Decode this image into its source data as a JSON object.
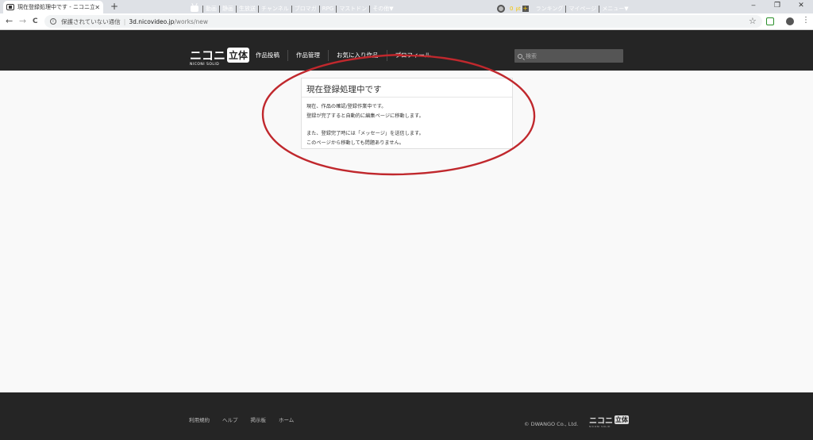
{
  "browser": {
    "tab_title": "現在登録処理中です - ニコニ立体",
    "tab_close": "✕",
    "new_tab": "+",
    "window_controls": {
      "minimize": "‒",
      "maximize": "❐",
      "close": "✕"
    },
    "nav": {
      "back": "←",
      "forward": "→",
      "reload": "C"
    },
    "security_label": "保護されていない通信",
    "url_host": "3d.nicovideo.jp",
    "url_path": "/works/new"
  },
  "topbar": {
    "links": [
      "動画",
      "静画",
      "生放送",
      "チャンネル",
      "ブロマガ",
      "RPG",
      "マストドン",
      "その他▼"
    ],
    "points": "0",
    "points_unit": "pt",
    "plus": "+",
    "right_links": [
      "ランキング",
      "マイページ",
      "メニュー▼"
    ]
  },
  "logo": {
    "text": "ニコニ",
    "box": "立体",
    "sub": "NICONI SOLID"
  },
  "main_nav": [
    "作品投稿",
    "作品管理",
    "お気に入り作品",
    "プロフィール"
  ],
  "search": {
    "placeholder": "検索"
  },
  "card": {
    "title": "現在登録処理中です",
    "line1": "現在、作品の確認/登録作業中です。",
    "line2": "登録が完了すると自動的に編集ページに移動します。",
    "line3": "また、登録完了時には「メッセージ」を送信します。",
    "line4": "このページから移動しても問題ありません。"
  },
  "footer": {
    "links": [
      "利用規約",
      "ヘルプ",
      "掲示板",
      "ホーム"
    ],
    "copyright": "© DWANGO Co., Ltd.",
    "logo_text": "ニコニ",
    "logo_box": "立体",
    "logo_sub": "NICONI SOLID"
  },
  "colors": {
    "header_bg": "#252525",
    "accent_points": "#f5c400",
    "annotation": "#c0282d",
    "page_bg": "#f9f9f9"
  }
}
